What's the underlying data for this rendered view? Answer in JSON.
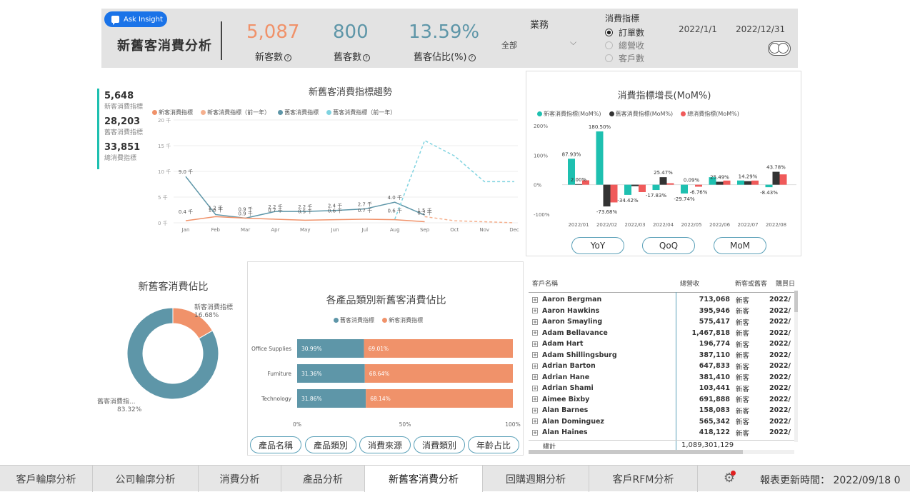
{
  "header": {
    "ask_label": "Ask Insight",
    "title": "新舊客消費分析",
    "kpis": [
      {
        "value": "5,087",
        "label": "新客數",
        "color": "#f0926a"
      },
      {
        "value": "800",
        "label": "舊客數",
        "color": "#5e96a8"
      },
      {
        "value": "13.59%",
        "label": "舊客佔比(%)",
        "color": "#5e96a8"
      }
    ],
    "business_label": "業務",
    "business_value": "全部",
    "metric_label": "消費指標",
    "metric_options": [
      "訂單數",
      "總營收",
      "客戶數"
    ],
    "date_start": "2022/1/1",
    "date_end": "2022/12/31"
  },
  "side_kpis": [
    {
      "value": "5,648",
      "label": "新客消費指標"
    },
    {
      "value": "28,203",
      "label": "舊客消費指標"
    },
    {
      "value": "33,851",
      "label": "總消費指標"
    }
  ],
  "trend": {
    "title": "新舊客消費指標趨勢",
    "legend": [
      "新客消費指標",
      "新客消費指標（前一年）",
      "舊客消費指標",
      "舊客消費指標（前一年）"
    ],
    "y_ticks": [
      "20 千",
      "15 千",
      "10 千",
      "5 千",
      "0 千"
    ],
    "months": [
      "Jan",
      "Feb",
      "Mar",
      "Apr",
      "May",
      "Jun",
      "Jul",
      "Aug",
      "Sep",
      "Oct",
      "Nov",
      "Dec"
    ],
    "old_labels": [
      "9.0 千",
      "1.6 千",
      "0.9 千",
      "2.2 千",
      "2.2 千",
      "2.4 千",
      "2.7 千",
      "4.0 千",
      "1.5 千"
    ],
    "new_labels": [
      "0.4 千",
      "1.2 千",
      "0.9 千",
      "0.7 千",
      "0.5 千",
      "0.6 千",
      "0.7 千",
      "0.6 千",
      "0.2 千"
    ]
  },
  "mom": {
    "title": "消費指標增長(MoM%)",
    "legend": [
      "新客消費指標(MoM%)",
      "舊客消費指標(MoM%)",
      "總消費指標(MoM%)"
    ],
    "y_ticks": [
      "200%",
      "100%",
      "0%",
      "-100%"
    ],
    "months": [
      "2022/01",
      "2022/02",
      "2022/03",
      "2022/04",
      "2022/05",
      "2022/06",
      "2022/07",
      "2022/08"
    ],
    "labels": [
      "87.93%",
      "2.00%",
      "180.50%",
      "-73.68%",
      "-34.42%",
      "-17.83%",
      "25.47%",
      "0.09%",
      "-29.74%",
      "-6.76%",
      "25.49%",
      "14.29%",
      "43.78%",
      "-8.43%"
    ],
    "buttons": [
      "YoY",
      "QoQ",
      "MoM"
    ]
  },
  "donut": {
    "title": "新舊客消費佔比",
    "new_label": "新客消費指標",
    "new_pct": "16.68%",
    "old_label": "舊客消費指...",
    "old_pct": "83.32%"
  },
  "category": {
    "title": "各產品類別新舊客消費佔比",
    "legend": [
      "舊客消費指標",
      "新客消費指標"
    ],
    "rows": [
      {
        "name": "Office Supplies",
        "old": "30.99%",
        "new": "69.01%"
      },
      {
        "name": "Furniture",
        "old": "31.36%",
        "new": "68.64%"
      },
      {
        "name": "Technology",
        "old": "31.86%",
        "new": "68.14%"
      }
    ],
    "x_ticks": [
      "0%",
      "50%",
      "100%"
    ],
    "buttons": [
      "產品名稱",
      "產品類別",
      "消費來源",
      "消費類別",
      "年齡占比"
    ]
  },
  "customer_table": {
    "headers": [
      "客戶名稱",
      "總營收",
      "新客或舊客",
      "購買日"
    ],
    "rows": [
      {
        "name": "Aaron Bergman",
        "revenue": "713,068",
        "type": "新客",
        "date": "2022/"
      },
      {
        "name": "Aaron Hawkins",
        "revenue": "395,946",
        "type": "新客",
        "date": "2022/"
      },
      {
        "name": "Aaron Smayling",
        "revenue": "575,417",
        "type": "新客",
        "date": "2022/"
      },
      {
        "name": "Adam Bellavance",
        "revenue": "1,467,818",
        "type": "新客",
        "date": "2022/"
      },
      {
        "name": "Adam Hart",
        "revenue": "196,774",
        "type": "新客",
        "date": "2022/"
      },
      {
        "name": "Adam Shillingsburg",
        "revenue": "387,110",
        "type": "新客",
        "date": "2022/"
      },
      {
        "name": "Adrian Barton",
        "revenue": "647,833",
        "type": "新客",
        "date": "2022/"
      },
      {
        "name": "Adrian Hane",
        "revenue": "381,410",
        "type": "新客",
        "date": "2022/"
      },
      {
        "name": "Adrian Shami",
        "revenue": "103,441",
        "type": "新客",
        "date": "2022/"
      },
      {
        "name": "Aimee Bixby",
        "revenue": "691,888",
        "type": "新客",
        "date": "2022/"
      },
      {
        "name": "Alan Barnes",
        "revenue": "158,083",
        "type": "新客",
        "date": "2022/"
      },
      {
        "name": "Alan Dominguez",
        "revenue": "565,342",
        "type": "新客",
        "date": "2022/"
      },
      {
        "name": "Alan Haines",
        "revenue": "418,122",
        "type": "新客",
        "date": "2022/"
      }
    ],
    "total_label": "總計",
    "total_value": "1,089,301,129"
  },
  "tabs": [
    "客戶輪廓分析",
    "公司輪廓分析",
    "消費分析",
    "產品分析",
    "新舊客消費分析",
    "回購週期分析",
    "客戶RFM分析"
  ],
  "footer": {
    "updated": "報表更新時間： 2022/09/18 0"
  },
  "chart_data": [
    {
      "type": "line",
      "title": "新舊客消費指標趨勢",
      "x": [
        "Jan",
        "Feb",
        "Mar",
        "Apr",
        "May",
        "Jun",
        "Jul",
        "Aug",
        "Sep",
        "Oct",
        "Nov",
        "Dec"
      ],
      "ylim": [
        0,
        20000
      ],
      "series": [
        {
          "name": "舊客消費指標",
          "values": [
            9000,
            1600,
            900,
            2200,
            2200,
            2400,
            2700,
            4000,
            1500,
            null,
            null,
            null
          ]
        },
        {
          "name": "新客消費指標",
          "values": [
            400,
            1200,
            900,
            700,
            500,
            600,
            700,
            600,
            200,
            null,
            null,
            null
          ]
        },
        {
          "name": "舊客消費指標（前一年）",
          "values": [
            null,
            null,
            null,
            null,
            null,
            null,
            null,
            700,
            16000,
            13000,
            8000,
            8000
          ]
        },
        {
          "name": "新客消費指標（前一年）",
          "values": [
            null,
            null,
            null,
            null,
            null,
            null,
            null,
            null,
            1200,
            400,
            200,
            0
          ]
        }
      ]
    },
    {
      "type": "bar",
      "title": "消費指標增長(MoM%)",
      "categories": [
        "2022/01",
        "2022/02",
        "2022/03",
        "2022/04",
        "2022/05",
        "2022/06",
        "2022/07",
        "2022/08"
      ],
      "ylim": [
        -100,
        200
      ],
      "series": [
        {
          "name": "新客消費指標(MoM%)",
          "values": [
            87.93,
            180.5,
            -34.42,
            -17.83,
            -29.74,
            25.49,
            14.29,
            -8.43
          ]
        },
        {
          "name": "舊客消費指標(MoM%)",
          "values": [
            2.0,
            -73.68,
            -5,
            25.47,
            0.09,
            10,
            12,
            43.78
          ]
        },
        {
          "name": "總消費指標(MoM%)",
          "values": [
            15,
            -60,
            -25,
            5,
            -6.76,
            14,
            14,
            35
          ]
        }
      ]
    },
    {
      "type": "pie",
      "title": "新舊客消費佔比",
      "categories": [
        "新客消費指標",
        "舊客消費指標"
      ],
      "values": [
        16.68,
        83.32
      ]
    },
    {
      "type": "bar",
      "title": "各產品類別新舊客消費佔比",
      "categories": [
        "Office Supplies",
        "Furniture",
        "Technology"
      ],
      "series": [
        {
          "name": "舊客消費指標",
          "values": [
            30.99,
            31.36,
            31.86
          ]
        },
        {
          "name": "新客消費指標",
          "values": [
            69.01,
            68.64,
            68.14
          ]
        }
      ]
    }
  ],
  "colors": {
    "new": "#f0926a",
    "old": "#5e96a8",
    "old_prev": "#7fd3e0",
    "teal": "#1ec0b0",
    "dark": "#333333",
    "red": "#f05a5a"
  }
}
